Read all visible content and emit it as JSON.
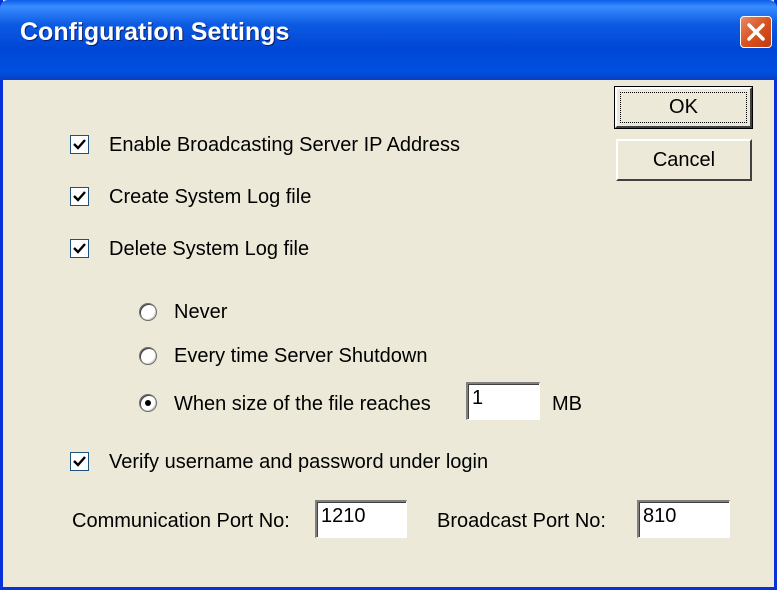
{
  "window": {
    "title": "Configuration Settings"
  },
  "buttons": {
    "ok": "OK",
    "cancel": "Cancel"
  },
  "checkboxes": {
    "broadcast": {
      "label": "Enable Broadcasting Server IP Address",
      "checked": true
    },
    "create_log": {
      "label": "Create System Log file",
      "checked": true
    },
    "delete_log": {
      "label": "Delete System Log file",
      "checked": true
    },
    "verify": {
      "label": "Verify username and password under login",
      "checked": true
    }
  },
  "delete_options": {
    "never": {
      "label": "Never",
      "selected": false
    },
    "shutdown": {
      "label": "Every time Server Shutdown",
      "selected": false
    },
    "size": {
      "label": "When size of the file reaches",
      "selected": true,
      "value": "1",
      "unit": "MB"
    }
  },
  "ports": {
    "communication_label": "Communication Port No:",
    "communication_value": "1210",
    "broadcast_label": "Broadcast Port No:",
    "broadcast_value": "810"
  },
  "colors": {
    "titlebar": "#0047d6",
    "dialog_bg": "#ece9d8",
    "close_button": "#d9531e"
  }
}
